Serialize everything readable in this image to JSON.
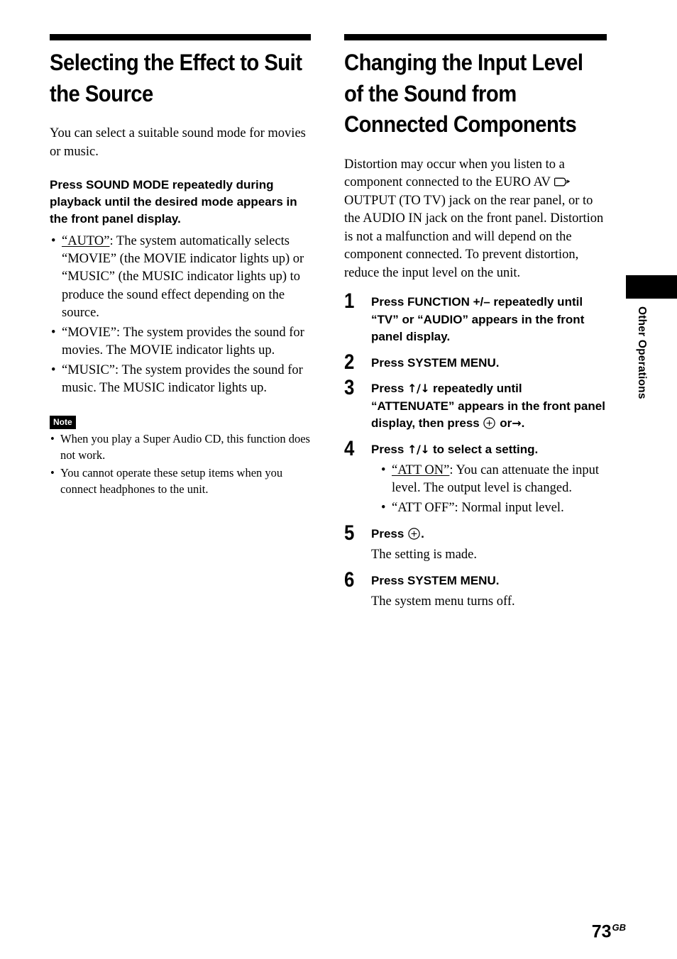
{
  "page": {
    "folio_number": "73",
    "folio_suffix": "GB",
    "thumb_tab_label": "Other Operations"
  },
  "left_column": {
    "heading": "Selecting the Effect to Suit the Source",
    "intro": "You can select a suitable sound mode for movies or music.",
    "instruction": "Press SOUND MODE repeatedly during playback until the desired mode appears in the front panel display.",
    "bullets": [
      {
        "underlined": "“AUTO”",
        "text": ": The system automatically selects “MOVIE” (the MOVIE indicator lights up) or “MUSIC” (the MUSIC indicator lights up) to produce the sound effect depending on the source."
      },
      {
        "underlined": "",
        "text": "“MOVIE”: The system provides the sound for movies. The MOVIE indicator lights up."
      },
      {
        "underlined": "",
        "text": "“MUSIC”: The system provides the sound for music. The MUSIC indicator lights up."
      }
    ],
    "note": {
      "badge": "Note",
      "items": [
        "When you play a Super Audio CD, this function does not work.",
        "You cannot operate these setup items when you connect headphones to the unit."
      ]
    }
  },
  "right_column": {
    "heading": "Changing the Input Level of the Sound from Connected Components",
    "intro_part1": "Distortion may occur when you listen to a component connected to the EURO AV",
    "intro_part2": "OUTPUT (TO TV) jack on the rear panel, or to the AUDIO IN jack on the front panel. Distortion is not a malfunction and will depend on the component connected. To prevent distortion, reduce the input level on the unit.",
    "steps": [
      {
        "number": "1",
        "title": "Press FUNCTION +/– repeatedly until “TV” or “AUDIO” appears in the front panel display.",
        "note": "",
        "bullets": []
      },
      {
        "number": "2",
        "title": "Press SYSTEM MENU.",
        "note": "",
        "bullets": []
      },
      {
        "number": "3",
        "title_pre": "Press",
        "title_arrows": "↑/↓",
        "title_mid": "repeatedly until “ATTENUATE” appears in the front panel display, then press",
        "title_post": "or",
        "title_end": ".",
        "note": "",
        "bullets": []
      },
      {
        "number": "4",
        "title_pre": "Press",
        "title_arrows": "↑/↓",
        "title_mid": "to select a setting.",
        "note": "",
        "bullets": [
          {
            "underlined": "“ATT ON”",
            "text": ": You can attenuate the input level. The output level is changed."
          },
          {
            "underlined": "",
            "text": "“ATT OFF”: Normal input level."
          }
        ]
      },
      {
        "number": "5",
        "title_pre": "Press",
        "title_end": ".",
        "note": "The setting is made.",
        "bullets": []
      },
      {
        "number": "6",
        "title": "Press SYSTEM MENU.",
        "note": "The system menu turns off.",
        "bullets": []
      }
    ]
  },
  "icons": {
    "enter_button": "enter-circle-icon",
    "scart_output": "scart-output-icon",
    "arrow_right": "→",
    "arrows_up_down": "↑/↓"
  }
}
